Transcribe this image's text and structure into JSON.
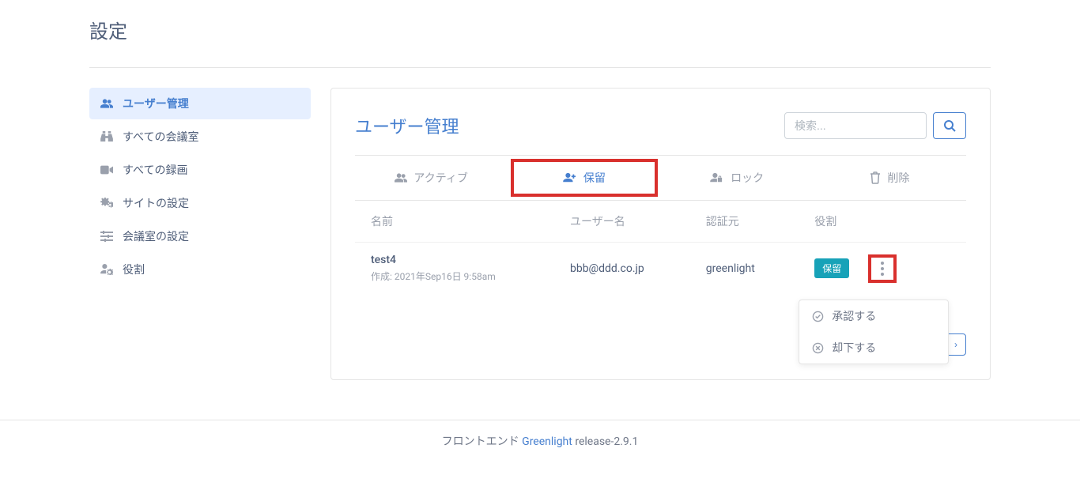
{
  "page": {
    "title": "設定"
  },
  "sidebar": {
    "items": [
      {
        "label": "ユーザー管理"
      },
      {
        "label": "すべての会議室"
      },
      {
        "label": "すべての録画"
      },
      {
        "label": "サイトの設定"
      },
      {
        "label": "会議室の設定"
      },
      {
        "label": "役割"
      }
    ]
  },
  "main": {
    "title": "ユーザー管理",
    "search_placeholder": "検索...",
    "tabs": {
      "active": "アクティブ",
      "pending": "保留",
      "lock": "ロック",
      "delete": "削除"
    },
    "columns": {
      "name": "名前",
      "username": "ユーザー名",
      "auth": "認証元",
      "role": "役割"
    },
    "users": [
      {
        "name": "test4",
        "created_prefix": "作成: ",
        "created": "2021年Sep16日 9:58am",
        "username": "bbb@ddd.co.jp",
        "auth": "greenlight",
        "role_badge": "保留"
      }
    ],
    "dropdown": {
      "approve": "承認する",
      "reject": "却下する"
    }
  },
  "footer": {
    "prefix": "フロントエンド ",
    "link": "Greenlight",
    "version": " release-2.9.1"
  }
}
